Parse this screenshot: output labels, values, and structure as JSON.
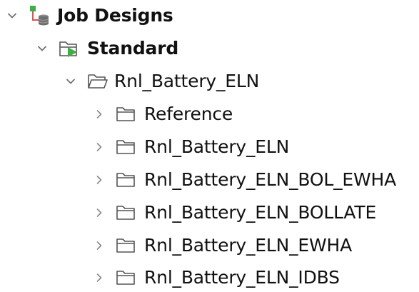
{
  "tree": {
    "root": {
      "label": "Job Designs",
      "icon": "job-designs-icon",
      "expanded": true
    },
    "standard": {
      "label": "Standard",
      "icon": "standard-folder-icon",
      "expanded": true
    },
    "project_folder": {
      "label": "Rnl_Battery_ELN",
      "icon": "folder-open-icon",
      "expanded": true
    },
    "children": [
      {
        "label": "Reference",
        "icon": "folder-icon",
        "expanded": false
      },
      {
        "label": "Rnl_Battery_ELN",
        "icon": "folder-icon",
        "expanded": false
      },
      {
        "label": "Rnl_Battery_ELN_BOL_EWHA",
        "icon": "folder-icon",
        "expanded": false
      },
      {
        "label": "Rnl_Battery_ELN_BOLLATE",
        "icon": "folder-icon",
        "expanded": false
      },
      {
        "label": "Rnl_Battery_ELN_EWHA",
        "icon": "folder-icon",
        "expanded": false
      },
      {
        "label": "Rnl_Battery_ELN_IDBS",
        "icon": "folder-icon",
        "expanded": false
      }
    ]
  },
  "colors": {
    "chevron": "#707070",
    "folder_stroke": "#555555",
    "green_accent": "#3cb043",
    "db_gray": "#6e6e6e",
    "connector_red": "#d9534f"
  }
}
